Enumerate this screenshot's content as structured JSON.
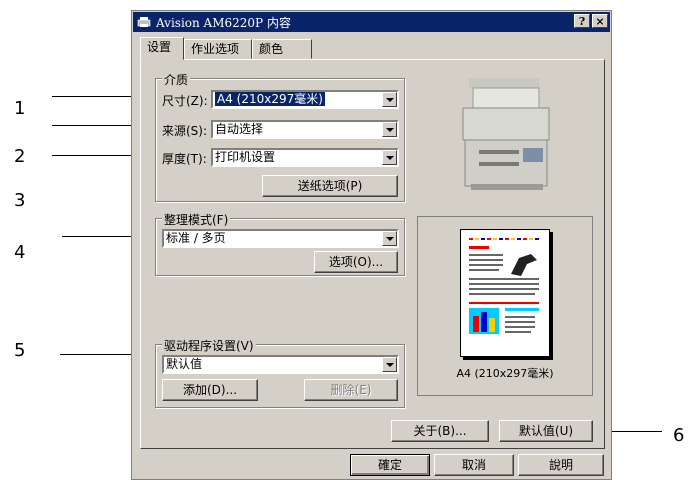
{
  "window": {
    "title": "Avision AM6220P 内容",
    "help_btn": "?",
    "close_btn": "×"
  },
  "tabs": [
    "设置",
    "作业选项",
    "颜色"
  ],
  "media_group": {
    "title": "介质",
    "size_label": "尺寸(Z):",
    "size_value": "A4 (210x297毫米)",
    "source_label": "来源(S):",
    "source_value": "自动选择",
    "weight_label": "厚度(T):",
    "weight_value": "打印机设置",
    "paper_options_btn": "送纸选项(P)"
  },
  "finishing_group": {
    "title": "整理模式(F)",
    "value": "标准 / 多页",
    "options_btn": "选项(O)..."
  },
  "driver_group": {
    "title": "驱动程序设置(V)",
    "value": "默认值",
    "add_btn": "添加(D)...",
    "delete_btn": "删除(E)"
  },
  "preview": {
    "caption": "A4 (210x297毫米)"
  },
  "panel_buttons": {
    "about": "关于(B)...",
    "defaults": "默认值(U)"
  },
  "dialog_buttons": {
    "ok": "確定",
    "cancel": "取消",
    "help": "說明"
  },
  "callouts": [
    "1",
    "2",
    "3",
    "4",
    "5",
    "6"
  ],
  "colors": {
    "titlebar": "#0a246a",
    "face": "#d4d0c8",
    "selection": "#0a246a"
  }
}
